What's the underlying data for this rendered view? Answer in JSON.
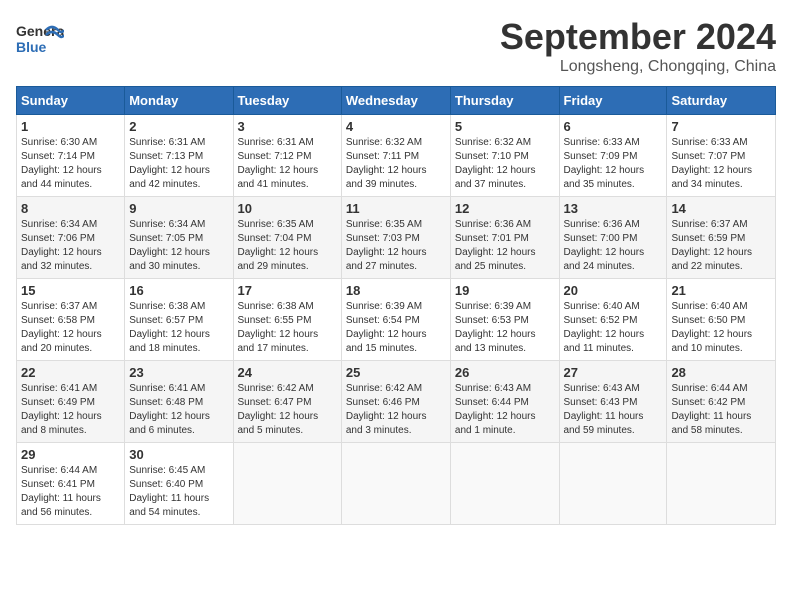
{
  "header": {
    "logo_line1": "General",
    "logo_line2": "Blue",
    "title": "September 2024",
    "subtitle": "Longsheng, Chongqing, China"
  },
  "weekdays": [
    "Sunday",
    "Monday",
    "Tuesday",
    "Wednesday",
    "Thursday",
    "Friday",
    "Saturday"
  ],
  "weeks": [
    [
      {
        "day": "1",
        "info": "Sunrise: 6:30 AM\nSunset: 7:14 PM\nDaylight: 12 hours\nand 44 minutes."
      },
      {
        "day": "2",
        "info": "Sunrise: 6:31 AM\nSunset: 7:13 PM\nDaylight: 12 hours\nand 42 minutes."
      },
      {
        "day": "3",
        "info": "Sunrise: 6:31 AM\nSunset: 7:12 PM\nDaylight: 12 hours\nand 41 minutes."
      },
      {
        "day": "4",
        "info": "Sunrise: 6:32 AM\nSunset: 7:11 PM\nDaylight: 12 hours\nand 39 minutes."
      },
      {
        "day": "5",
        "info": "Sunrise: 6:32 AM\nSunset: 7:10 PM\nDaylight: 12 hours\nand 37 minutes."
      },
      {
        "day": "6",
        "info": "Sunrise: 6:33 AM\nSunset: 7:09 PM\nDaylight: 12 hours\nand 35 minutes."
      },
      {
        "day": "7",
        "info": "Sunrise: 6:33 AM\nSunset: 7:07 PM\nDaylight: 12 hours\nand 34 minutes."
      }
    ],
    [
      {
        "day": "8",
        "info": "Sunrise: 6:34 AM\nSunset: 7:06 PM\nDaylight: 12 hours\nand 32 minutes."
      },
      {
        "day": "9",
        "info": "Sunrise: 6:34 AM\nSunset: 7:05 PM\nDaylight: 12 hours\nand 30 minutes."
      },
      {
        "day": "10",
        "info": "Sunrise: 6:35 AM\nSunset: 7:04 PM\nDaylight: 12 hours\nand 29 minutes."
      },
      {
        "day": "11",
        "info": "Sunrise: 6:35 AM\nSunset: 7:03 PM\nDaylight: 12 hours\nand 27 minutes."
      },
      {
        "day": "12",
        "info": "Sunrise: 6:36 AM\nSunset: 7:01 PM\nDaylight: 12 hours\nand 25 minutes."
      },
      {
        "day": "13",
        "info": "Sunrise: 6:36 AM\nSunset: 7:00 PM\nDaylight: 12 hours\nand 24 minutes."
      },
      {
        "day": "14",
        "info": "Sunrise: 6:37 AM\nSunset: 6:59 PM\nDaylight: 12 hours\nand 22 minutes."
      }
    ],
    [
      {
        "day": "15",
        "info": "Sunrise: 6:37 AM\nSunset: 6:58 PM\nDaylight: 12 hours\nand 20 minutes."
      },
      {
        "day": "16",
        "info": "Sunrise: 6:38 AM\nSunset: 6:57 PM\nDaylight: 12 hours\nand 18 minutes."
      },
      {
        "day": "17",
        "info": "Sunrise: 6:38 AM\nSunset: 6:55 PM\nDaylight: 12 hours\nand 17 minutes."
      },
      {
        "day": "18",
        "info": "Sunrise: 6:39 AM\nSunset: 6:54 PM\nDaylight: 12 hours\nand 15 minutes."
      },
      {
        "day": "19",
        "info": "Sunrise: 6:39 AM\nSunset: 6:53 PM\nDaylight: 12 hours\nand 13 minutes."
      },
      {
        "day": "20",
        "info": "Sunrise: 6:40 AM\nSunset: 6:52 PM\nDaylight: 12 hours\nand 11 minutes."
      },
      {
        "day": "21",
        "info": "Sunrise: 6:40 AM\nSunset: 6:50 PM\nDaylight: 12 hours\nand 10 minutes."
      }
    ],
    [
      {
        "day": "22",
        "info": "Sunrise: 6:41 AM\nSunset: 6:49 PM\nDaylight: 12 hours\nand 8 minutes."
      },
      {
        "day": "23",
        "info": "Sunrise: 6:41 AM\nSunset: 6:48 PM\nDaylight: 12 hours\nand 6 minutes."
      },
      {
        "day": "24",
        "info": "Sunrise: 6:42 AM\nSunset: 6:47 PM\nDaylight: 12 hours\nand 5 minutes."
      },
      {
        "day": "25",
        "info": "Sunrise: 6:42 AM\nSunset: 6:46 PM\nDaylight: 12 hours\nand 3 minutes."
      },
      {
        "day": "26",
        "info": "Sunrise: 6:43 AM\nSunset: 6:44 PM\nDaylight: 12 hours\nand 1 minute."
      },
      {
        "day": "27",
        "info": "Sunrise: 6:43 AM\nSunset: 6:43 PM\nDaylight: 11 hours\nand 59 minutes."
      },
      {
        "day": "28",
        "info": "Sunrise: 6:44 AM\nSunset: 6:42 PM\nDaylight: 11 hours\nand 58 minutes."
      }
    ],
    [
      {
        "day": "29",
        "info": "Sunrise: 6:44 AM\nSunset: 6:41 PM\nDaylight: 11 hours\nand 56 minutes."
      },
      {
        "day": "30",
        "info": "Sunrise: 6:45 AM\nSunset: 6:40 PM\nDaylight: 11 hours\nand 54 minutes."
      },
      {
        "day": "",
        "info": ""
      },
      {
        "day": "",
        "info": ""
      },
      {
        "day": "",
        "info": ""
      },
      {
        "day": "",
        "info": ""
      },
      {
        "day": "",
        "info": ""
      }
    ]
  ]
}
